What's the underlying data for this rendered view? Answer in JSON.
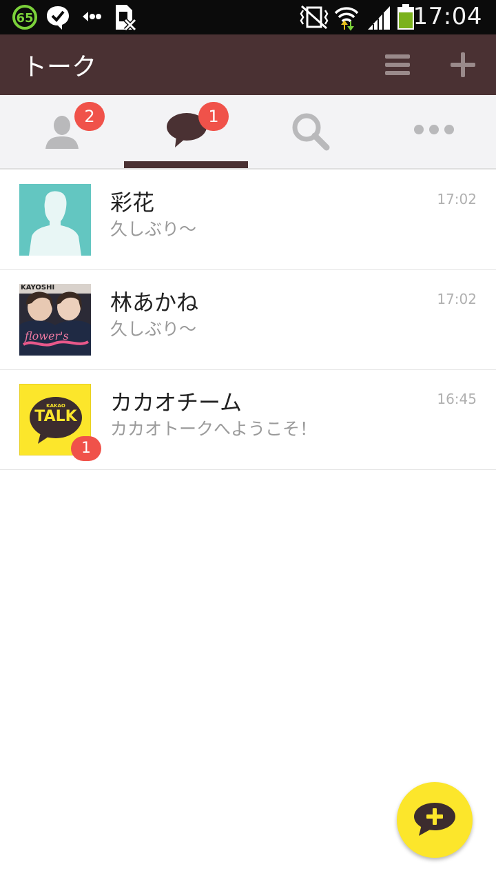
{
  "status_bar": {
    "time": "17:04",
    "badge_number": "65",
    "icons": [
      "update-65-icon",
      "check-bubble-icon",
      "data-transfer-icon",
      "sim-x-icon",
      "vibrate-icon",
      "wifi-icon",
      "signal-icon",
      "battery-icon"
    ]
  },
  "app_bar": {
    "title": "トーク",
    "icons": [
      "menu-icon",
      "add-icon"
    ]
  },
  "tabs": [
    {
      "name": "friends",
      "icon": "person-icon",
      "badge": "2",
      "active": false
    },
    {
      "name": "chats",
      "icon": "chat-bubble-icon",
      "badge": "1",
      "active": true
    },
    {
      "name": "search",
      "icon": "search-icon",
      "badge": "",
      "active": false
    },
    {
      "name": "more",
      "icon": "more-icon",
      "badge": "",
      "active": false
    }
  ],
  "chats": [
    {
      "name": "彩花",
      "preview": "久しぶり〜",
      "time": "17:02",
      "avatar": "default-avatar-icon"
    },
    {
      "name": "林あかね",
      "preview": "久しぶり〜",
      "time": "17:02",
      "avatar": "photo-avatar",
      "photo_caption": "KAYOSHI",
      "photo_text": "flower's"
    },
    {
      "name": "カカオチーム",
      "preview": "カカオトークへようこそ！",
      "time": "16:45",
      "avatar": "kakao-talk-logo",
      "logo_small": "KAKAO",
      "logo_text": "TALK",
      "unread": "1"
    }
  ],
  "fab": {
    "icon": "new-chat-icon"
  },
  "colors": {
    "status_bar": "#0b0b0b",
    "app_bar": "#4a3133",
    "tab_bar": "#f3f3f5",
    "badge": "#f0524a",
    "fab": "#fce62b",
    "default_avatar": "#63c6c1",
    "kakao_yellow": "#fce62b"
  }
}
